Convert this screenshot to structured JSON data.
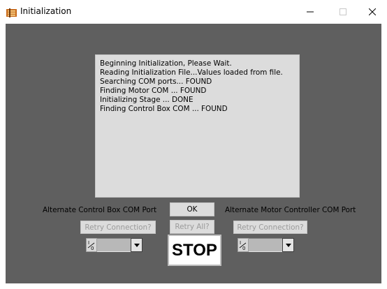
{
  "window": {
    "title": "Initialization",
    "icon": "instrument-panel-icon"
  },
  "log": {
    "lines": [
      "Beginning Initialization, Please Wait.",
      "",
      "Reading Initialization File...Values loaded from file.",
      "Searching COM ports... FOUND",
      "Finding Motor COM ... FOUND",
      "Initializing Stage ... DONE",
      "Finding Control Box COM ... FOUND"
    ]
  },
  "controls": {
    "alt_control_box_label": "Alternate Control Box COM Port",
    "ok_label": "OK",
    "alt_motor_label": "Alternate Motor Controller COM Port",
    "retry_left_label": "Retry Connection?",
    "retry_all_label": "Retry All?",
    "retry_right_label": "Retry Connection?",
    "stop_label": "STOP",
    "left_com_value": "",
    "right_com_value": ""
  }
}
